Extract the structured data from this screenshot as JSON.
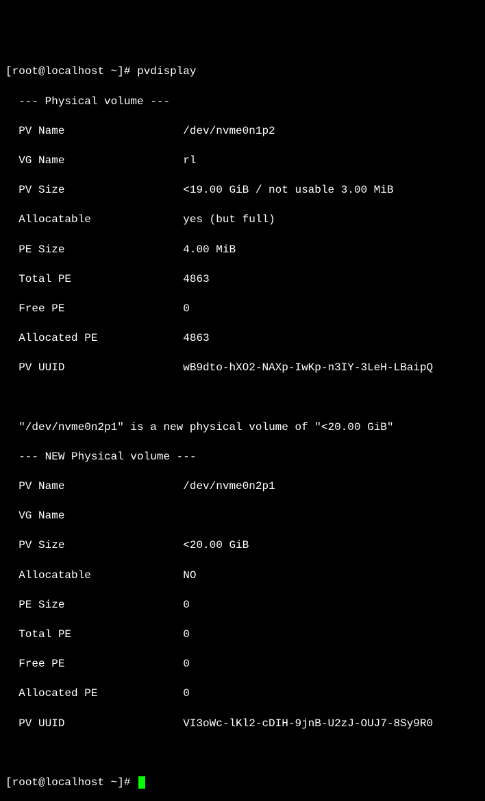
{
  "prompt1": {
    "user": "root",
    "host": "localhost",
    "path": "~",
    "symbol": "#",
    "command": "pvdisplay"
  },
  "pv1": {
    "header": "--- Physical volume ---",
    "fields": [
      {
        "label": "PV Name",
        "value": "/dev/nvme0n1p2"
      },
      {
        "label": "VG Name",
        "value": "rl"
      },
      {
        "label": "PV Size",
        "value": "<19.00 GiB / not usable 3.00 MiB"
      },
      {
        "label": "Allocatable",
        "value": "yes (but full)"
      },
      {
        "label": "PE Size",
        "value": "4.00 MiB"
      },
      {
        "label": "Total PE",
        "value": "4863"
      },
      {
        "label": "Free PE",
        "value": "0"
      },
      {
        "label": "Allocated PE",
        "value": "4863"
      },
      {
        "label": "PV UUID",
        "value": "wB9dto-hXO2-NAXp-IwKp-n3IY-3LeH-LBaipQ"
      }
    ]
  },
  "notice": "\"/dev/nvme0n2p1\" is a new physical volume of \"<20.00 GiB\"",
  "pv2": {
    "header": "--- NEW Physical volume ---",
    "fields": [
      {
        "label": "PV Name",
        "value": "/dev/nvme0n2p1"
      },
      {
        "label": "VG Name",
        "value": ""
      },
      {
        "label": "PV Size",
        "value": "<20.00 GiB"
      },
      {
        "label": "Allocatable",
        "value": "NO"
      },
      {
        "label": "PE Size",
        "value": "0"
      },
      {
        "label": "Total PE",
        "value": "0"
      },
      {
        "label": "Free PE",
        "value": "0"
      },
      {
        "label": "Allocated PE",
        "value": "0"
      },
      {
        "label": "PV UUID",
        "value": "VI3oWc-lKl2-cDIH-9jnB-U2zJ-OUJ7-8Sy9R0"
      }
    ]
  },
  "prompt2": {
    "user": "root",
    "host": "localhost",
    "path": "~",
    "symbol": "#",
    "command": ""
  }
}
